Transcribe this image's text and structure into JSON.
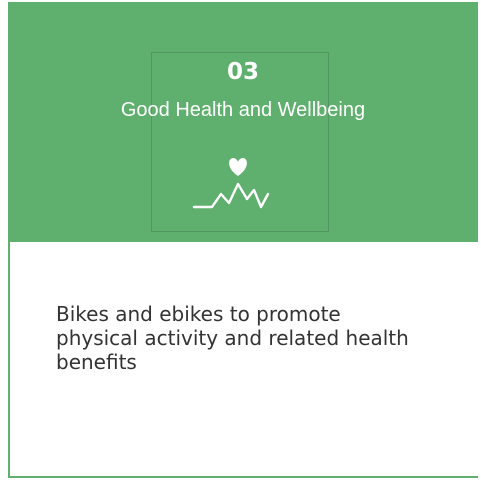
{
  "goal": {
    "number": "03",
    "title": "Good Health and Wellbeing",
    "icon": "heart-pulse-icon",
    "color": "#5faf6e"
  },
  "description": "Bikes and ebikes to promote physical activity and related health benefits"
}
